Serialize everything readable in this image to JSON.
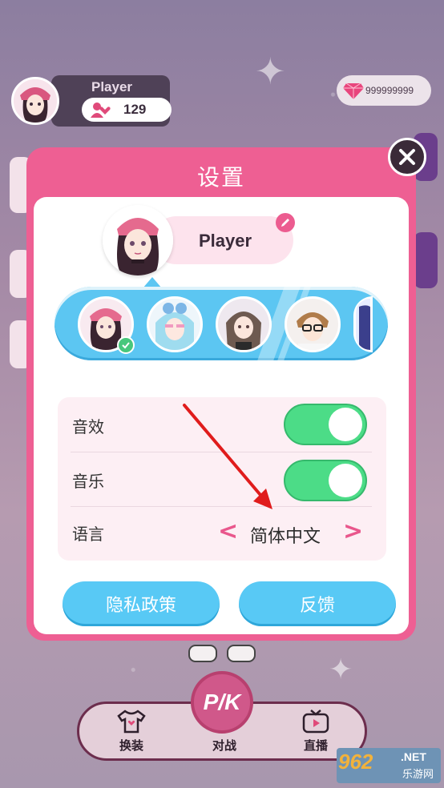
{
  "hud": {
    "player_name": "Player",
    "likes": "129",
    "gems": "999999999"
  },
  "modal": {
    "title": "设置",
    "player_name": "Player",
    "settings": {
      "sound_label": "音效",
      "sound_on": true,
      "music_label": "音乐",
      "music_on": true,
      "language_label": "语言",
      "language_value": "简体中文",
      "prev_symbol": "<",
      "next_symbol": ">"
    },
    "buttons": {
      "privacy": "隐私政策",
      "feedback": "反馈"
    }
  },
  "bottom_nav": {
    "dress": "换装",
    "battle": "对战",
    "pk": "P/K",
    "live": "直播"
  },
  "watermark": {
    "number": "962",
    "net": ".NET",
    "sub": "乐游网"
  },
  "colors": {
    "accent_pink": "#ee5f93",
    "toggle_green": "#4cdc87",
    "button_blue": "#58c9f5",
    "annotation_arrow": "#e01c1c"
  }
}
